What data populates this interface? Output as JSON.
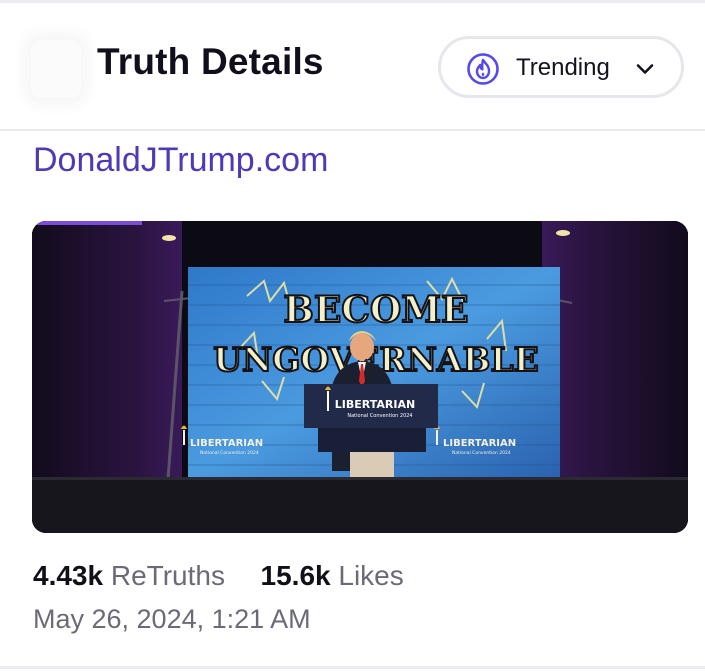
{
  "header": {
    "title": "Truth Details",
    "feed_filter": {
      "selected": "Trending",
      "icon": "flame-icon",
      "chevron_icon": "chevron-down-icon"
    },
    "back_icon": "back-icon"
  },
  "post": {
    "link_text": "DonaldJTrump.com",
    "image": {
      "screen_text": [
        "BECOME",
        "UNGOVERNABLE"
      ],
      "podium_text": "LIBERTARIAN",
      "podium_subtext": "National Convention 2024",
      "side_banner_text": "LIBERTARIAN",
      "side_banner_subtext": "National Convention 2024"
    },
    "retruths_count": "4.43k",
    "retruths_label": "ReTruths",
    "likes_count": "15.6k",
    "likes_label": "Likes",
    "timestamp": "May 26, 2024, 1:21 AM"
  },
  "colors": {
    "link": "#4c3bb5",
    "accent": "#5448ee",
    "muted_text": "#6c6a78",
    "divider": "#e8e8ee"
  }
}
